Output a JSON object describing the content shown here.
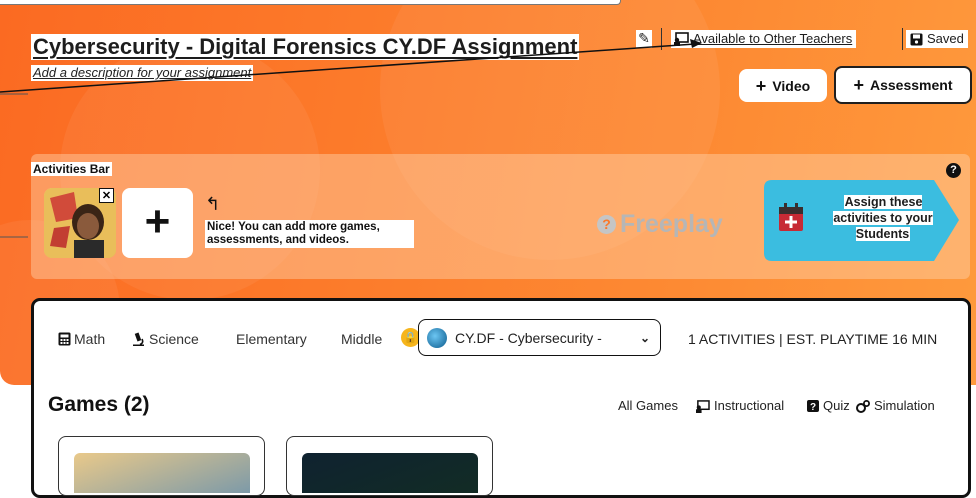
{
  "header": {
    "title": "Cybersecurity - Digital Forensics CY.DF Assignment",
    "description_placeholder": "Add a description for your assignment",
    "availability": "Available to Other Teachers",
    "save_status": "Saved"
  },
  "actions": {
    "video_label": "Video",
    "assessment_label": "Assessment"
  },
  "activities_bar": {
    "label": "Activities Bar",
    "hint": "Nice! You can add more games, assessments, and videos.",
    "mode": "Freeplay",
    "assign_button": "Assign these activities to your Students"
  },
  "filters": {
    "subjects": [
      "Math",
      "Science"
    ],
    "levels": [
      "Elementary",
      "Middle"
    ],
    "course_select": "CY.DF - Cybersecurity -",
    "summary": "1 ACTIVITIES | EST. PLAYTIME 16 MIN"
  },
  "games": {
    "title": "Games (2)",
    "types": [
      "All Games",
      "Instructional",
      "Quiz",
      "Simulation"
    ]
  },
  "colors": {
    "brand_orange": "#fb6a22",
    "assign_blue": "#3bbde0",
    "calendar_red": "#c72a35"
  }
}
